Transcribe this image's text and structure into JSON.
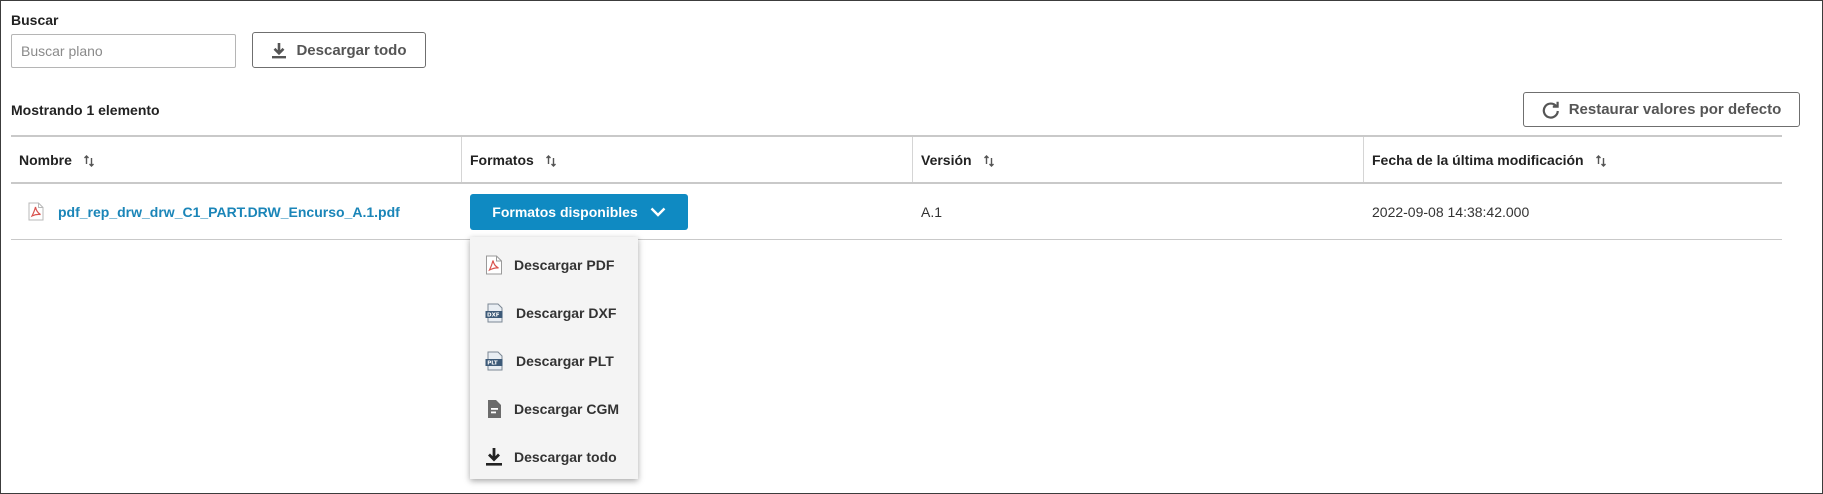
{
  "search": {
    "label": "Buscar",
    "placeholder": "Buscar plano"
  },
  "toolbar": {
    "download_all_label": "Descargar todo",
    "restore_label": "Restaurar valores por defecto"
  },
  "summary": {
    "showing": "Mostrando 1 elemento"
  },
  "table": {
    "columns": [
      "Nombre",
      "Formatos",
      "Versión",
      "Fecha de la última modificación"
    ],
    "rows": [
      {
        "name": "pdf_rep_drw_drw_C1_PART.DRW_Encurso_A.1.pdf",
        "formats_button": "Formatos disponibles",
        "version": "A.1",
        "modified": "2022-09-08 14:38:42.000"
      }
    ]
  },
  "dropdown": {
    "items": [
      {
        "label": "Descargar PDF",
        "icon": "pdf-icon"
      },
      {
        "label": "Descargar DXF",
        "icon": "dxf-icon"
      },
      {
        "label": "Descargar PLT",
        "icon": "plt-icon"
      },
      {
        "label": "Descargar CGM",
        "icon": "cgm-icon"
      },
      {
        "label": "Descargar todo",
        "icon": "download-icon"
      }
    ]
  },
  "colors": {
    "accent": "#0f8ac2",
    "link": "#1a85b8",
    "pdf_red": "#d9534f"
  }
}
